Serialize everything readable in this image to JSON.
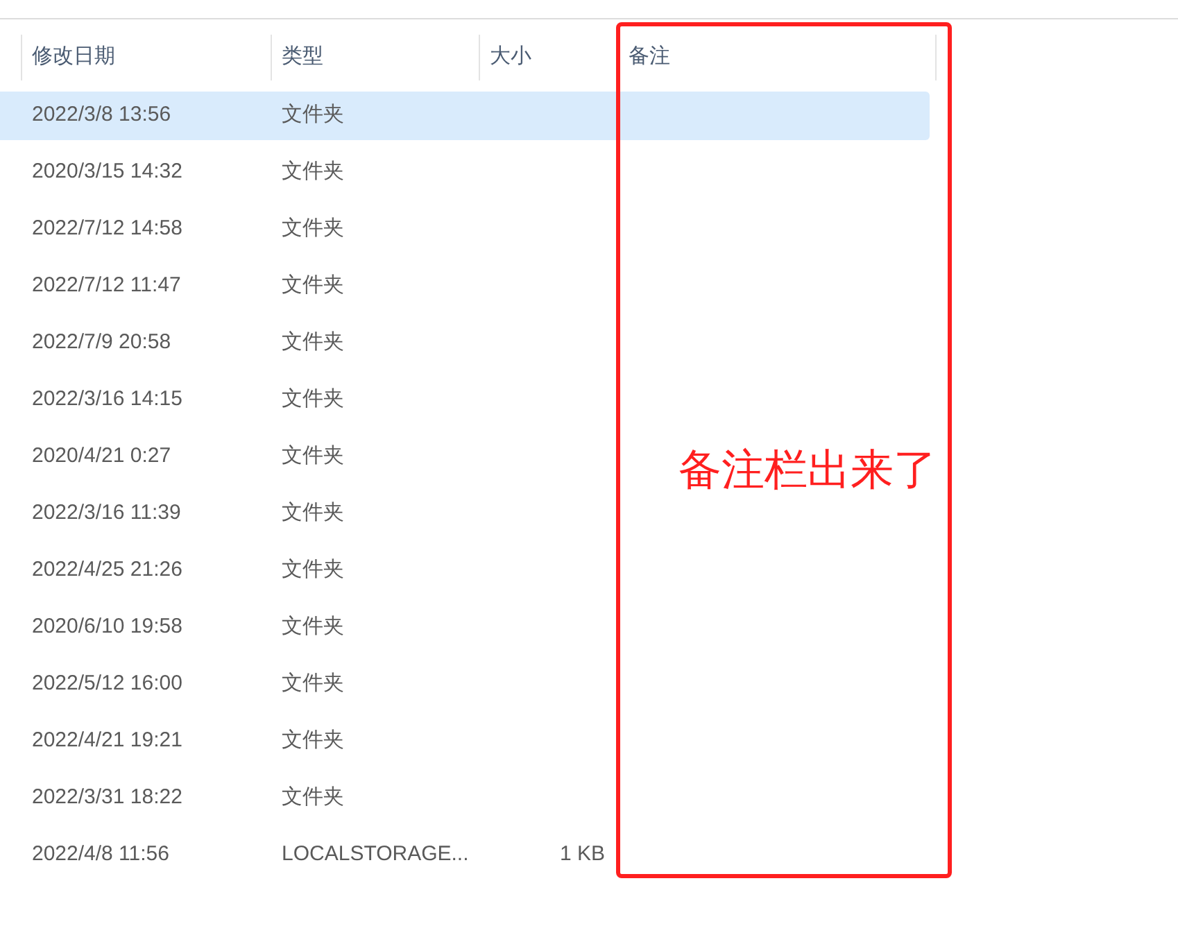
{
  "columns": [
    "修改日期",
    "类型",
    "大小",
    "备注"
  ],
  "rows": [
    {
      "date": "2022/3/8 13:56",
      "type": "文件夹",
      "selected": true
    },
    {
      "date": "2020/3/15 14:32",
      "type": "文件夹",
      "selected": false
    },
    {
      "date": "2022/7/12 14:58",
      "type": "文件夹",
      "selected": false
    },
    {
      "date": "2022/7/12 11:47",
      "type": "文件夹",
      "selected": false
    },
    {
      "date": "2022/7/9 20:58",
      "type": "文件夹",
      "selected": false
    },
    {
      "date": "2022/3/16 14:15",
      "type": "文件夹",
      "selected": false
    },
    {
      "date": "2020/4/21 0:27",
      "type": "文件夹",
      "selected": false
    },
    {
      "date": "2022/3/16 11:39",
      "type": "文件夹",
      "selected": false
    },
    {
      "date": "2022/4/25 21:26",
      "type": "文件夹",
      "selected": false
    },
    {
      "date": "2020/6/10 19:58",
      "type": "文件夹",
      "selected": false
    },
    {
      "date": "2022/5/12 16:00",
      "type": "文件夹",
      "selected": false
    },
    {
      "date": "2022/4/21 19:21",
      "type": "文件夹",
      "selected": false
    },
    {
      "date": "2022/3/31 18:22",
      "type": "文件夹",
      "selected": false
    },
    {
      "date": "2022/4/8 11:56",
      "type": "LOCALSTORAGE...",
      "size": "1 KB",
      "selected": false
    }
  ],
  "annotation": {
    "label": "备注栏出来了"
  }
}
